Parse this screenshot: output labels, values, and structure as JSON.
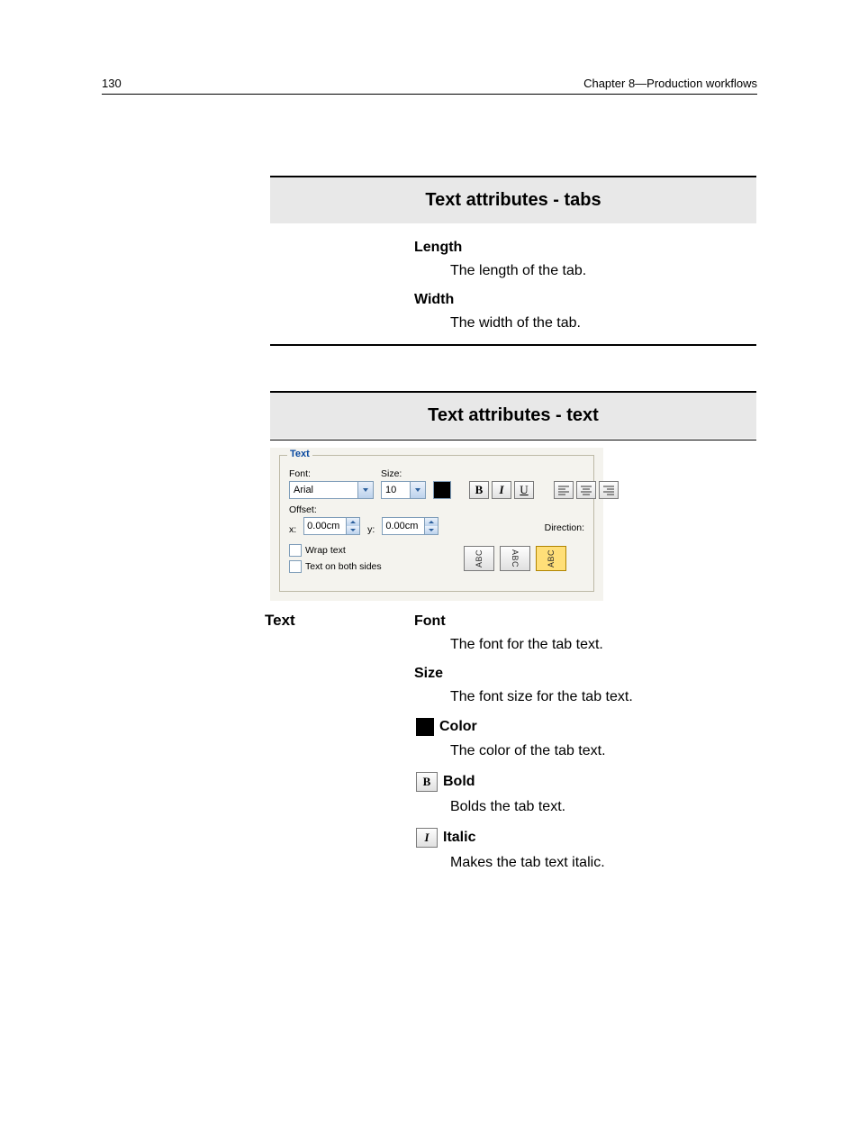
{
  "header": {
    "page_number": "130",
    "chapter": "Chapter 8—Production workflows"
  },
  "section_tabs": {
    "title": "Text attributes - tabs",
    "items": [
      {
        "term": "Length",
        "desc": "The length of the tab."
      },
      {
        "term": "Width",
        "desc": "The width of the tab."
      }
    ]
  },
  "section_text": {
    "title": "Text attributes - text",
    "panel": {
      "legend": "Text",
      "font_label": "Font:",
      "font_value": "Arial",
      "size_label": "Size:",
      "size_value": "10",
      "offset_label": "Offset:",
      "x_label": "x:",
      "x_value": "0.00cm",
      "y_label": "y:",
      "y_value": "0.00cm",
      "wrap_label": "Wrap text",
      "both_sides_label": "Text on both sides",
      "direction_label": "Direction:",
      "bold_glyph": "B",
      "italic_glyph": "I",
      "underline_glyph": "U",
      "dir_text": "ABC"
    },
    "sub_label": "Text",
    "items": [
      {
        "icon": null,
        "term": "Font",
        "desc": "The font for the tab text."
      },
      {
        "icon": null,
        "term": "Size",
        "desc": "The font size for the tab text."
      },
      {
        "icon": "color",
        "term": "Color",
        "desc": "The color of the tab text."
      },
      {
        "icon": "bold",
        "term": "Bold",
        "desc": "Bolds the tab text."
      },
      {
        "icon": "italic",
        "term": "Italic",
        "desc": "Makes the tab text italic."
      }
    ]
  }
}
